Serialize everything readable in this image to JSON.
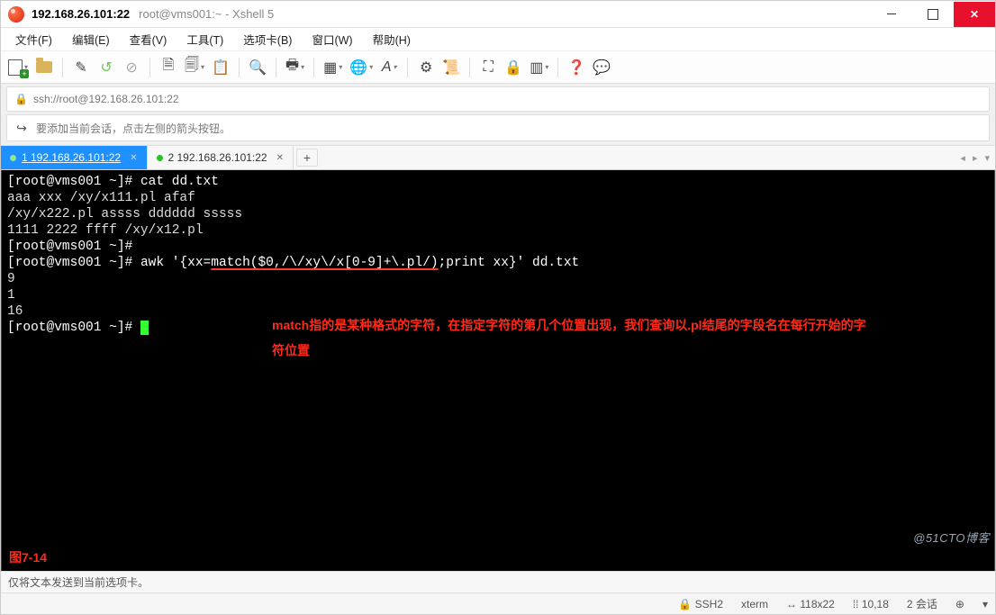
{
  "title": {
    "active": "192.168.26.101:22",
    "sub": "root@vms001:~ - Xshell 5"
  },
  "menu": {
    "file": "文件(F)",
    "edit": "编辑(E)",
    "view": "查看(V)",
    "tools": "工具(T)",
    "tabs": "选项卡(B)",
    "window": "窗口(W)",
    "help": "帮助(H)"
  },
  "address": {
    "url": "ssh://root@192.168.26.101:22"
  },
  "hint": {
    "text": "要添加当前会话，点击左侧的箭头按钮。"
  },
  "tabs": {
    "items": [
      {
        "label": "1 192.168.26.101:22",
        "active": true
      },
      {
        "label": "2 192.168.26.101:22",
        "active": false
      }
    ],
    "nav_left": "◂",
    "nav_right": "▸",
    "nav_menu": "▾"
  },
  "terminal": {
    "lines": [
      {
        "prompt": "[root@vms001 ~]# ",
        "cmd": "cat dd.txt"
      },
      {
        "plain": "aaa xxx /xy/x111.pl afaf"
      },
      {
        "plain": "/xy/x222.pl assss dddddd sssss"
      },
      {
        "plain": "1111 2222 ffff /xy/x12.pl"
      },
      {
        "prompt": "[root@vms001 ~]#",
        "cmd": ""
      },
      {
        "prompt": "[root@vms001 ~]# ",
        "cmd_pre": "awk '{xx=",
        "cmd_mark": "match($0,/\\/xy\\/x[0-9]+\\.pl/)",
        "cmd_post": ";print xx}' dd.txt"
      },
      {
        "plain": "9"
      },
      {
        "plain": "1"
      },
      {
        "plain": "16"
      },
      {
        "prompt": "[root@vms001 ~]# ",
        "cursor": true
      }
    ],
    "annotation": "match指的是某种格式的字符，在指定字符的第几个位置出现，我们查询以.pl结尾的字段名在每行开始的字符位置",
    "fig_label": "图7-14"
  },
  "status1": {
    "text": "仅将文本发送到当前选项卡。"
  },
  "status2": {
    "protocol_icon": "🔒",
    "protocol": "SSH2",
    "termtype": "xterm",
    "size_icon": "↔",
    "size": "118x22",
    "pos_icon": "⁞⁞",
    "pos": "10,18",
    "sessions": "2 会话",
    "caps_icon": "⊕",
    "num_icon": "▾"
  },
  "watermark": "@51CTO博客"
}
